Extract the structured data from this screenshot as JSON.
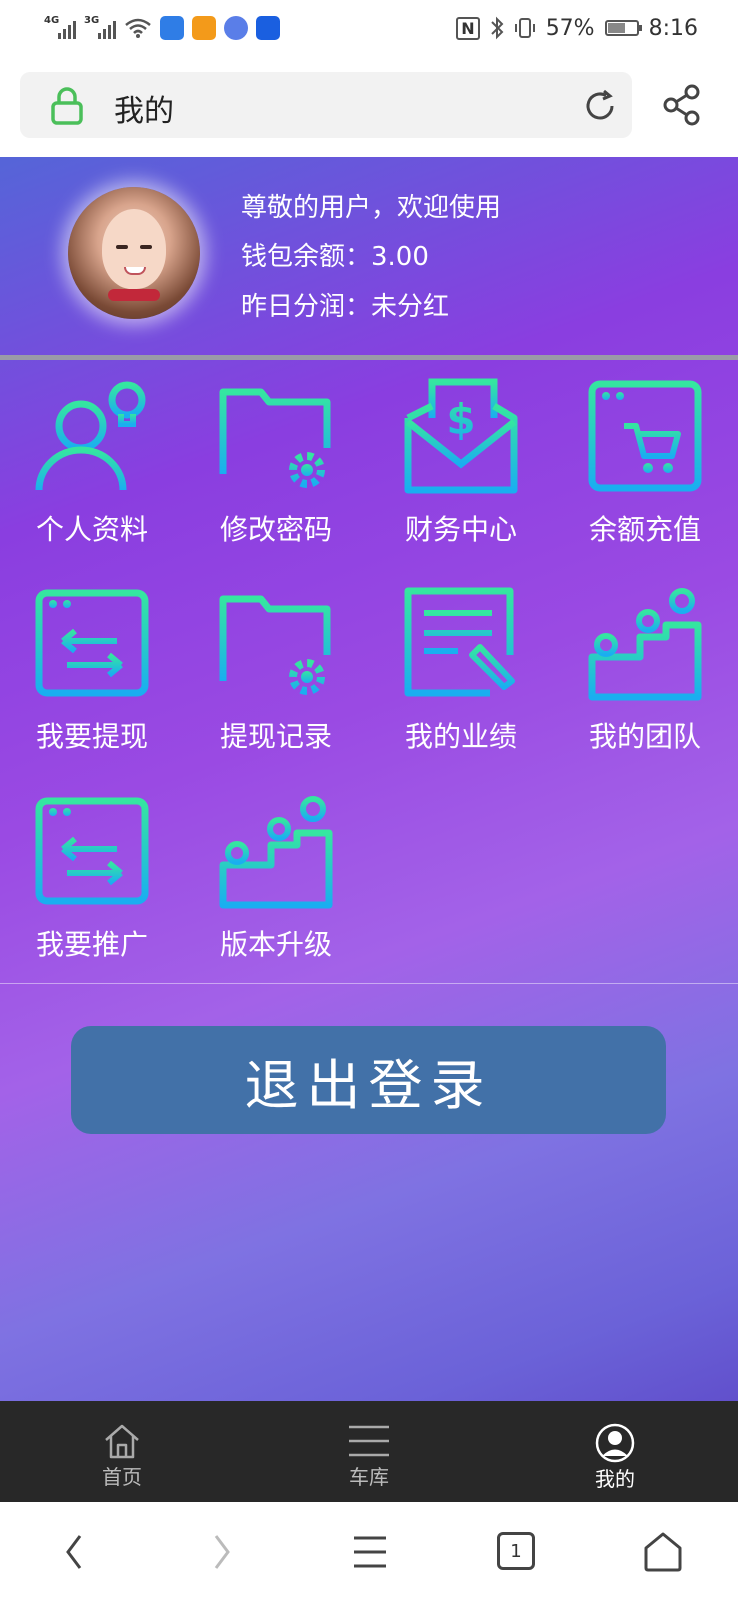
{
  "status_bar": {
    "signal1_tag": "4G",
    "signal2_tag": "3G",
    "battery_percent": "57%",
    "battery_level": 0.57,
    "time": "8:16",
    "nfc": "N"
  },
  "address_bar": {
    "title": "我的"
  },
  "profile": {
    "greeting": "尊敬的用户，欢迎使用",
    "wallet": "钱包余额：3.00",
    "dividend": "昨日分润：未分红"
  },
  "menu": [
    {
      "label": "个人资料",
      "icon": "user-idea-icon"
    },
    {
      "label": "修改密码",
      "icon": "folder-gear-icon"
    },
    {
      "label": "财务中心",
      "icon": "money-envelope-icon"
    },
    {
      "label": "余额充值",
      "icon": "browser-cart-icon"
    },
    {
      "label": "我要提现",
      "icon": "browser-transfer-icon"
    },
    {
      "label": "提现记录",
      "icon": "folder-gear-icon"
    },
    {
      "label": "我的业绩",
      "icon": "document-edit-icon"
    },
    {
      "label": "我的团队",
      "icon": "team-icon"
    },
    {
      "label": "我要推广",
      "icon": "browser-transfer-icon"
    },
    {
      "label": "版本升级",
      "icon": "team-icon"
    }
  ],
  "logout_label": "退出登录",
  "tabbar": {
    "home": "首页",
    "garage": "车库",
    "mine": "我的"
  },
  "sysnav": {
    "tab_count": "1"
  }
}
